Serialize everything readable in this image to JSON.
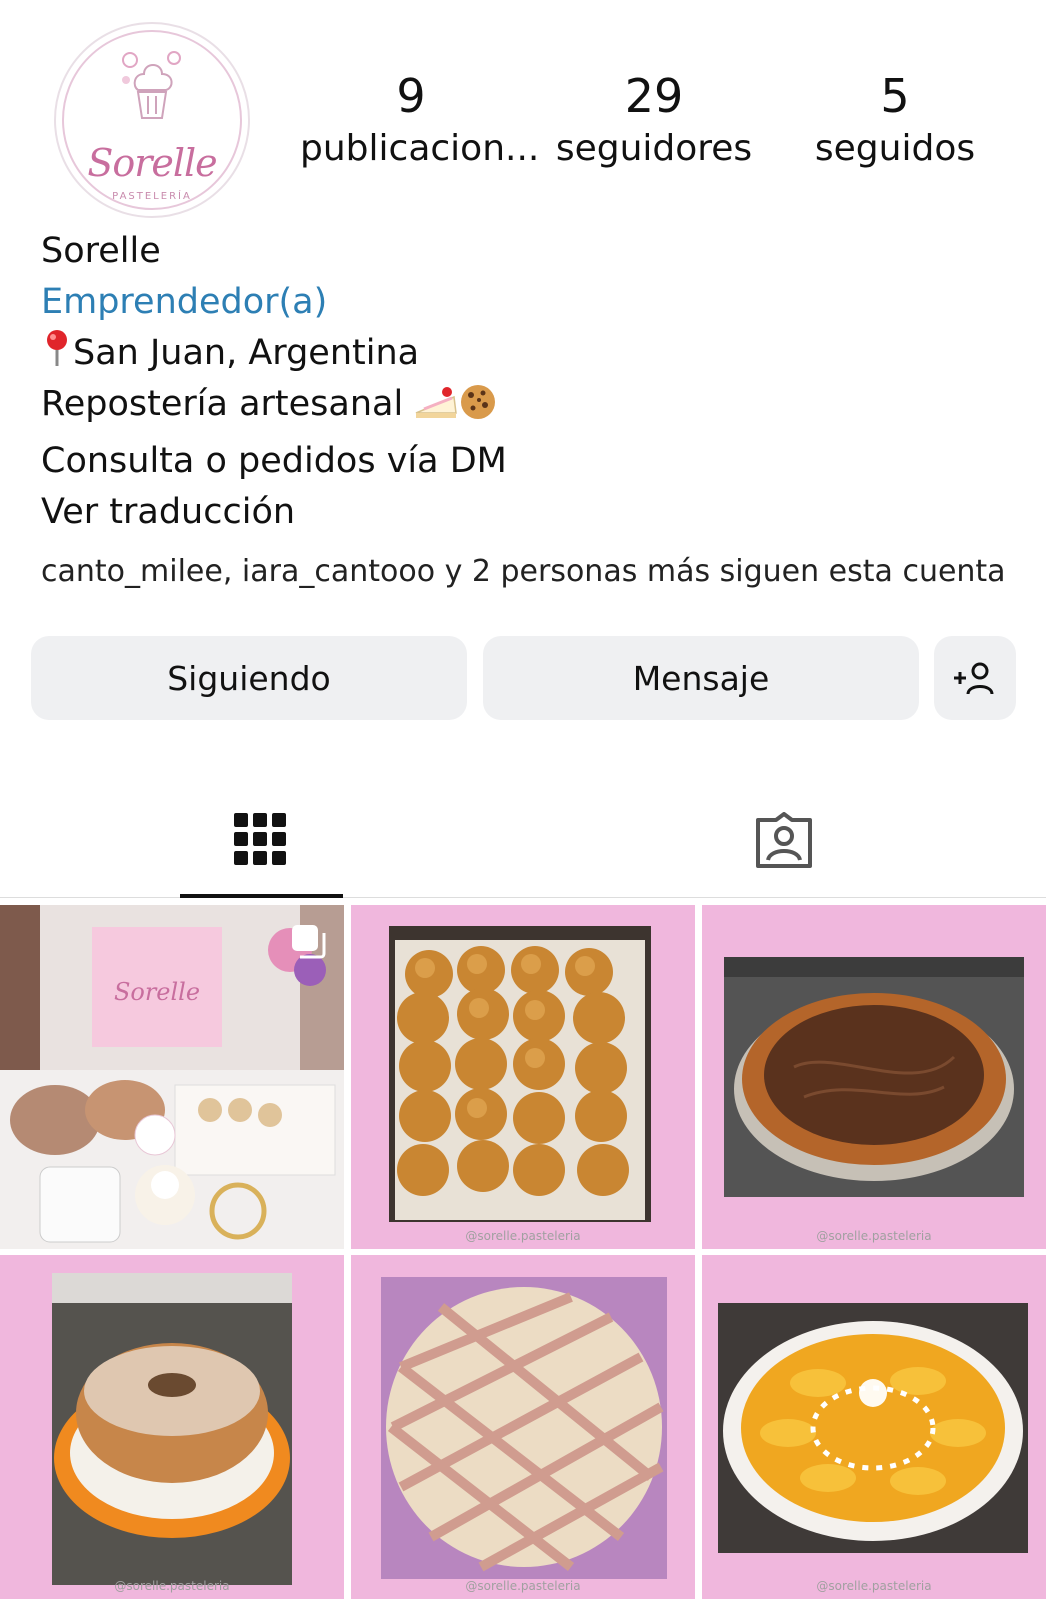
{
  "profile": {
    "avatar_brand": "Sorelle",
    "avatar_sub": "PASTELERÍA",
    "stats": [
      {
        "value": "9",
        "label": "publicacion..."
      },
      {
        "value": "29",
        "label": "seguidores"
      },
      {
        "value": "5",
        "label": "seguidos"
      }
    ],
    "name": "Sorelle",
    "category": "Emprendedor(a)",
    "location": "San Juan, Argentina",
    "bio_line1": "Repostería artesanal",
    "bio_line2": "Consulta o pedidos vía DM",
    "translate": "Ver traducción",
    "followed_by": "canto_milee, iara_cantooo y 2 personas más siguen esta cuenta",
    "category_color": "#2d7fb4"
  },
  "actions": {
    "following_label": "Siguiendo",
    "message_label": "Mensaje",
    "add_person_icon": "add-person-icon"
  },
  "tabs": [
    {
      "icon": "grid-icon",
      "active": true
    },
    {
      "icon": "tagged-icon",
      "active": false
    }
  ],
  "posts": [
    {
      "caption": "",
      "multi": true
    },
    {
      "caption": "@sorelle.pasteleria"
    },
    {
      "caption": "@sorelle.pasteleria"
    },
    {
      "caption": "@sorelle.pasteleria"
    },
    {
      "caption": "@sorelle.pasteleria"
    },
    {
      "caption": "@sorelle.pasteleria"
    }
  ],
  "colors": {
    "tile_pink": "#f0b7dd",
    "button_bg": "#eff0f2"
  }
}
